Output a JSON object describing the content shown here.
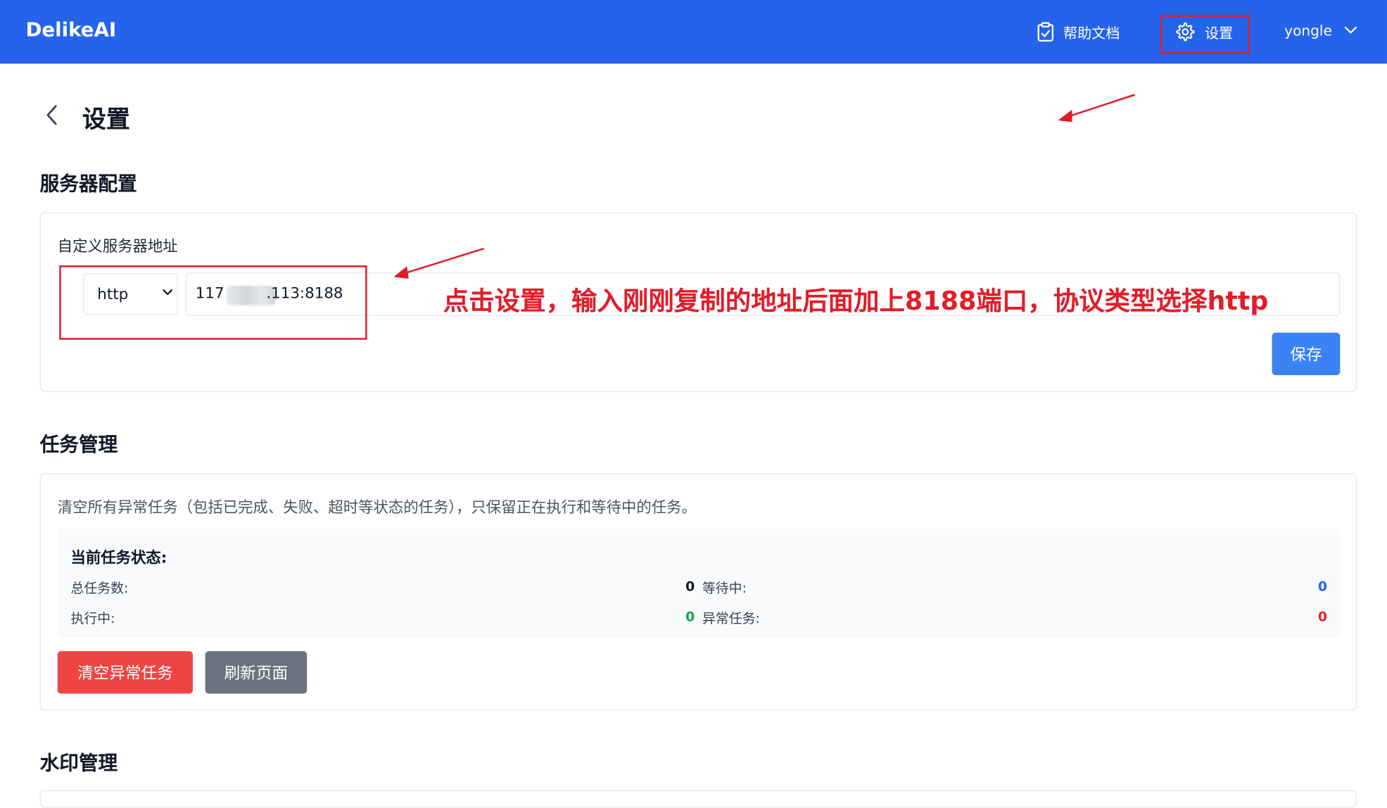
{
  "header": {
    "brand": "DelikeAI",
    "help_label": "帮助文档",
    "settings_label": "设置",
    "user_name": "yongle",
    "bg_color": "#2563eb"
  },
  "page": {
    "title": "设置"
  },
  "server": {
    "section_title": "服务器配置",
    "field_label": "自定义服务器地址",
    "protocol_value": "http",
    "address_prefix": "117",
    "address_suffix": ".113:8188",
    "save_label": "保存"
  },
  "annotation": {
    "note": "点击设置，输入刚刚复制的地址后面加上8188端口，协议类型选择http",
    "color": "#e11d2a"
  },
  "tasks": {
    "section_title": "任务管理",
    "description": "清空所有异常任务（包括已完成、失败、超时等状态的任务），只保留正在执行和等待中的任务。",
    "status_title": "当前任务状态:",
    "stats": [
      {
        "label": "总任务数:",
        "value": "0",
        "color": "#111827"
      },
      {
        "label": "等待中:",
        "value": "0",
        "color": "#2563eb"
      },
      {
        "label": "执行中:",
        "value": "0",
        "color": "#16a34a"
      },
      {
        "label": "异常任务:",
        "value": "0",
        "color": "#dc2626"
      }
    ],
    "clear_label": "清空异常任务",
    "refresh_label": "刷新页面"
  },
  "watermark": {
    "section_title": "水印管理"
  },
  "icons": {
    "help": "clipboard-check-icon",
    "settings": "gear-icon",
    "user_menu": "chevron-down-icon",
    "back": "chevron-left-icon",
    "protocol": "chevron-down-icon"
  }
}
